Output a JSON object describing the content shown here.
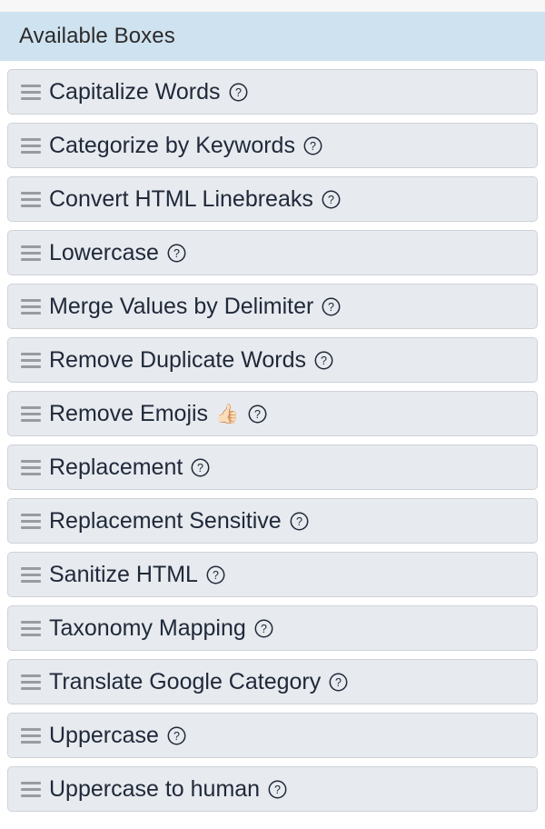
{
  "panel": {
    "header_title": "Available Boxes",
    "header_bg": "#cfe2f0",
    "row_bg": "#e7eaee",
    "row_border": "#ced2d8",
    "text_color": "#20293a",
    "handle_color": "#9a9ba1"
  },
  "icons": {
    "drag_handle": "drag-handle-icon",
    "help": "help-circle-icon"
  },
  "boxes": [
    {
      "label": "Capitalize Words",
      "emoji": "",
      "help": "?"
    },
    {
      "label": "Categorize by Keywords",
      "emoji": "",
      "help": "?"
    },
    {
      "label": "Convert HTML Linebreaks",
      "emoji": "",
      "help": "?"
    },
    {
      "label": "Lowercase",
      "emoji": "",
      "help": "?"
    },
    {
      "label": "Merge Values by Delimiter",
      "emoji": "",
      "help": "?"
    },
    {
      "label": "Remove Duplicate Words",
      "emoji": "",
      "help": "?"
    },
    {
      "label": "Remove Emojis",
      "emoji": "👍🏻",
      "help": "?"
    },
    {
      "label": "Replacement",
      "emoji": "",
      "help": "?"
    },
    {
      "label": "Replacement Sensitive",
      "emoji": "",
      "help": "?"
    },
    {
      "label": "Sanitize HTML",
      "emoji": "",
      "help": "?"
    },
    {
      "label": "Taxonomy Mapping",
      "emoji": "",
      "help": "?"
    },
    {
      "label": "Translate Google Category",
      "emoji": "",
      "help": "?"
    },
    {
      "label": "Uppercase",
      "emoji": "",
      "help": "?"
    },
    {
      "label": "Uppercase to human",
      "emoji": "",
      "help": "?"
    }
  ]
}
